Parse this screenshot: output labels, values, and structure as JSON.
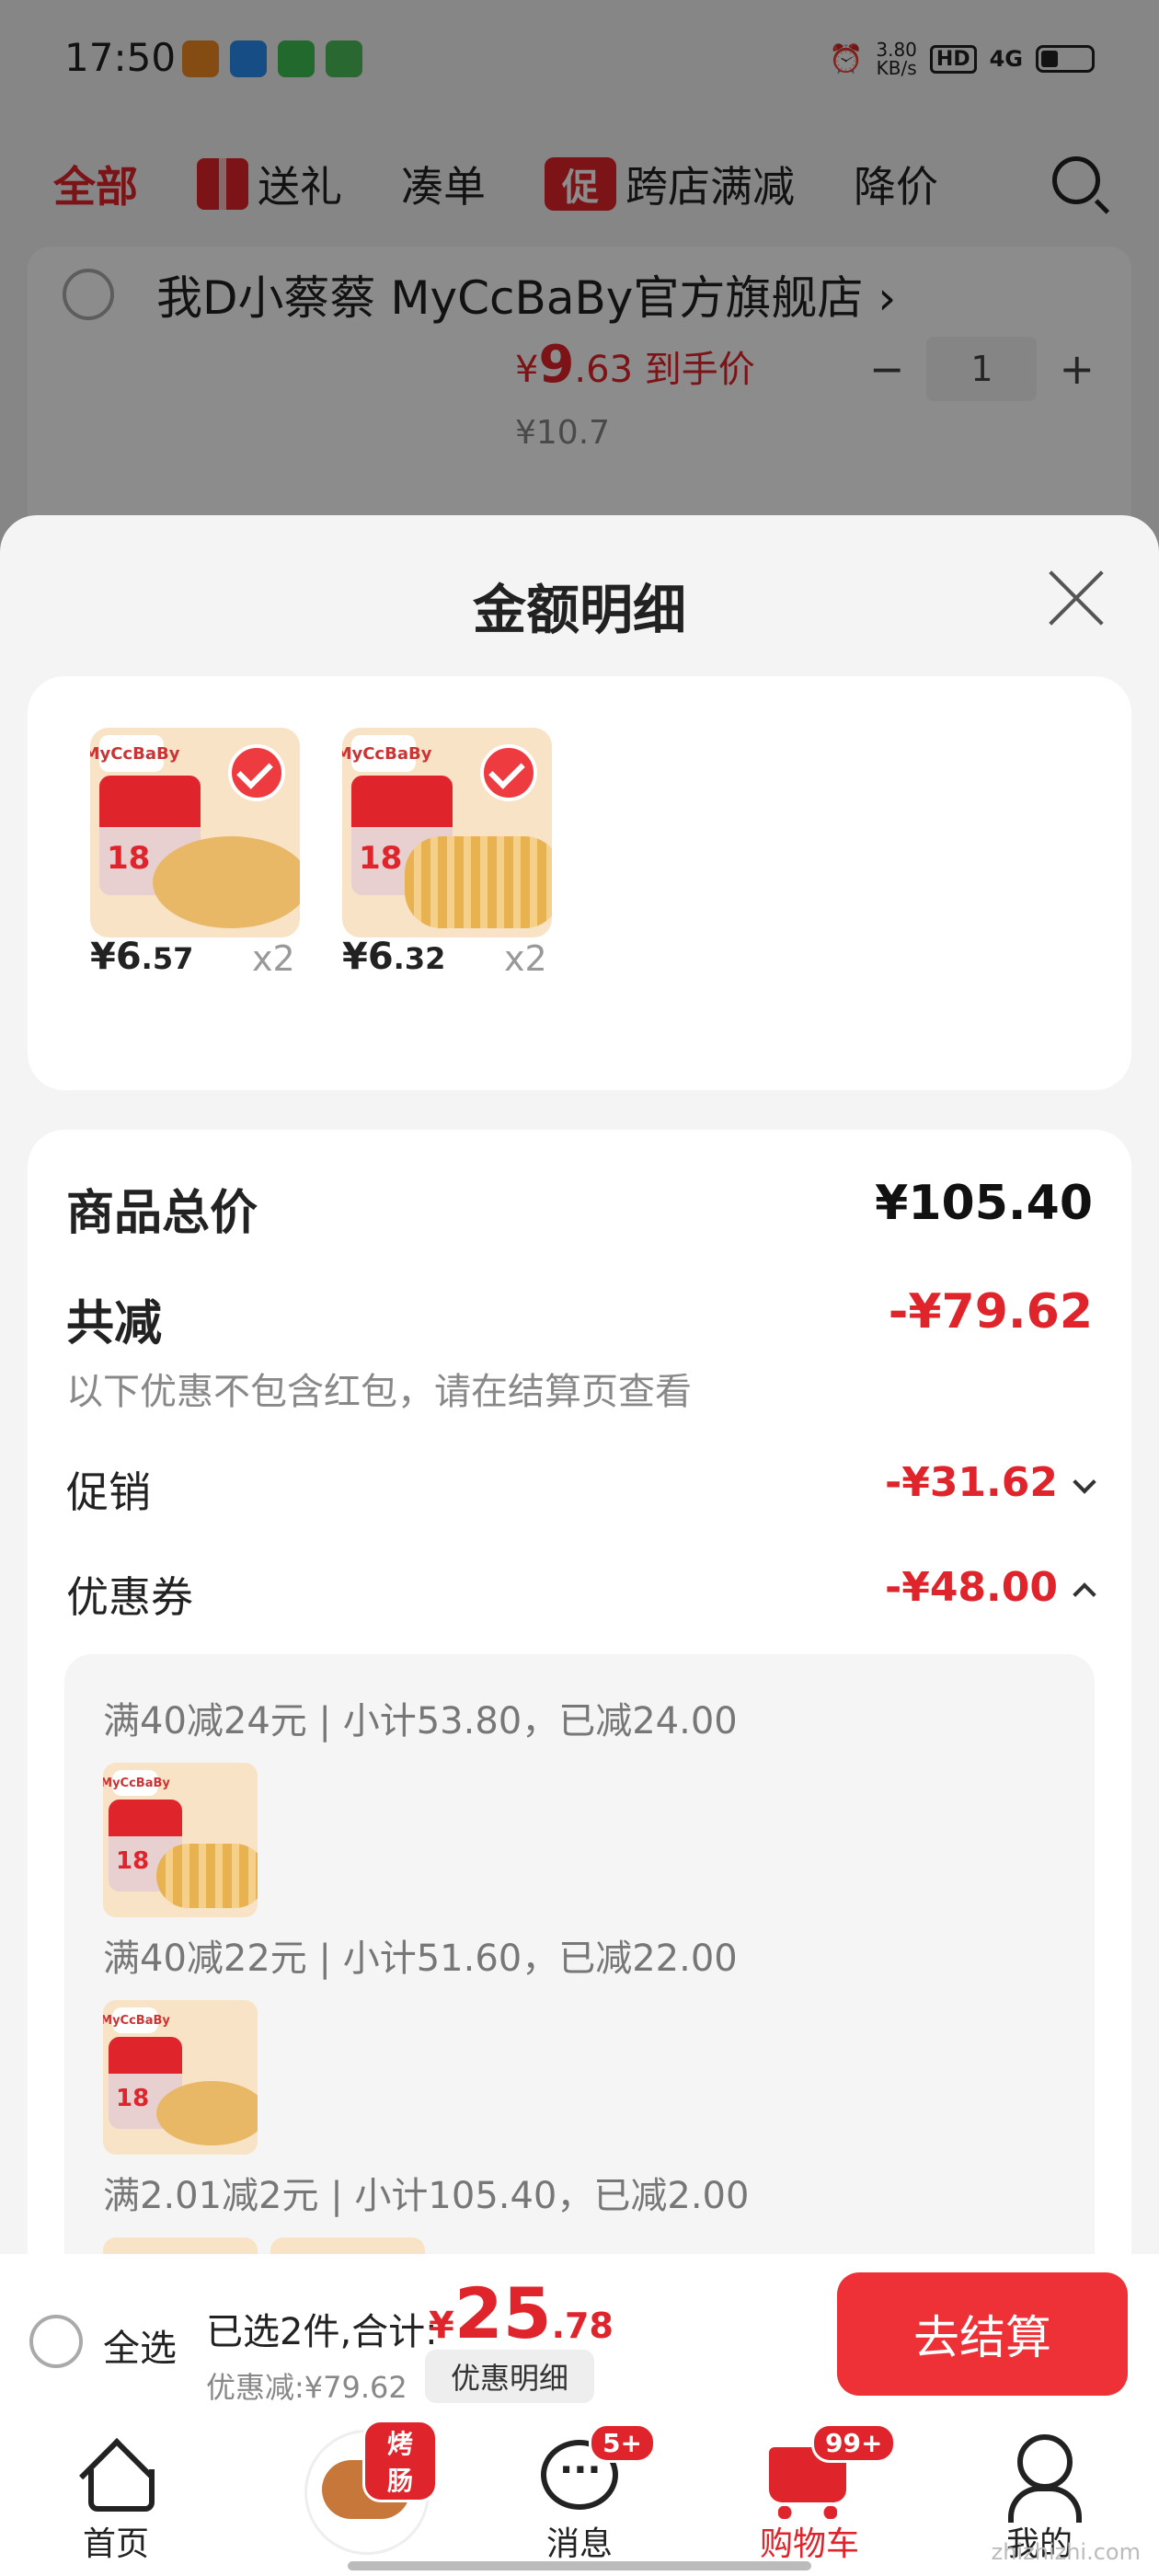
{
  "status_bar": {
    "time": "17:50",
    "speed": "3.80",
    "speed_unit": "KB/s",
    "hd": "HD",
    "network": "4G"
  },
  "top_tabs": [
    {
      "label": "全部",
      "active": true
    },
    {
      "label": "送礼"
    },
    {
      "label": "凑单"
    },
    {
      "label": "跨店满减",
      "tag": "促"
    },
    {
      "label": "降价"
    }
  ],
  "store": {
    "name": "我D小蔡蔡 MyCcBaBy官方旗舰店",
    "chevron": "›",
    "price_symbol": "¥",
    "price_int": "9",
    "price_dec": ".63",
    "price_suffix": "到手价",
    "old_price": "¥10.7",
    "qty": "1",
    "minus": "−",
    "plus": "+"
  },
  "sheet": {
    "title": "金额明细",
    "items": [
      {
        "brand": "MyCcBaBy",
        "price_int": "¥6",
        "price_dec": ".57",
        "qty": "x2"
      },
      {
        "brand": "MyCcBaBy",
        "price_int": "¥6",
        "price_dec": ".32",
        "qty": "x2"
      }
    ],
    "total_label": "商品总价",
    "total_value": "¥105.40",
    "reduce_label": "共减",
    "reduce_value": "-¥79.62",
    "note": "以下优惠不包含红包，请在结算页查看",
    "promo_label": "促销",
    "promo_value": "-¥31.62",
    "coupon_label": "优惠券",
    "coupon_value": "-¥48.00",
    "coupon_lines": [
      "满40减24元 | 小计53.80，已减24.00",
      "满40减22元 | 小计51.60，已减22.00",
      "满2.01减2元 | 小计105.40，已减2.00"
    ]
  },
  "checkout": {
    "select_all": "全选",
    "selected": "已选2件,合计:",
    "price_symbol": "¥",
    "price_int": "25",
    "price_dec": ".78",
    "discount": "优惠减:¥79.62",
    "detail_button": "优惠明细",
    "checkout_button": "去结算"
  },
  "bottom_nav": {
    "home": "首页",
    "promo_badge": "烤肠",
    "messages": "消息",
    "messages_badge": "5+",
    "cart": "购物车",
    "cart_badge": "99+",
    "me": "我的"
  },
  "watermark": "zhizhizhi.com",
  "colors": {
    "accent": "#e0242b",
    "checkout_button": "#ee3136"
  }
}
